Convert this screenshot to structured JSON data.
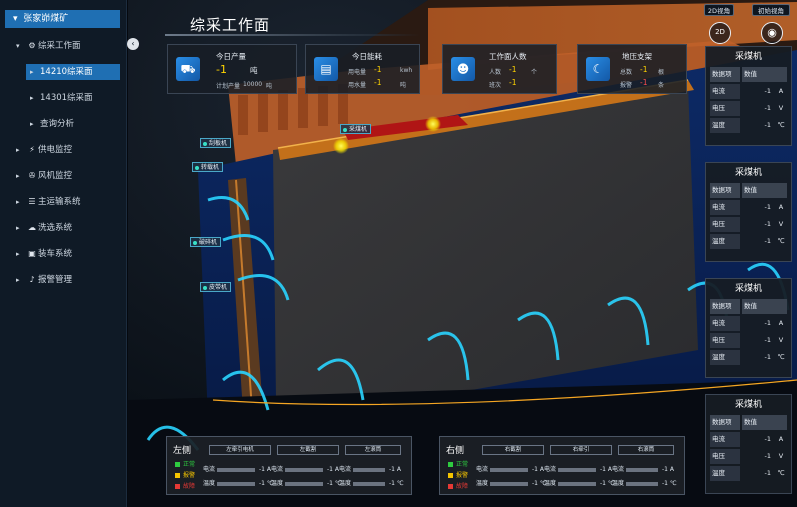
{
  "sidebar": {
    "root": "张家峁煤矿",
    "items": [
      {
        "label": "综采工作面",
        "icon": "gear"
      },
      {
        "label": "14210综采面"
      },
      {
        "label": "14301综采面"
      },
      {
        "label": "查询分析"
      },
      {
        "label": "供电监控",
        "icon": "lightning"
      },
      {
        "label": "风机监控",
        "icon": "fan"
      },
      {
        "label": "主运输系统",
        "icon": "conveyor"
      },
      {
        "label": "洗选系统",
        "icon": "wash"
      },
      {
        "label": "装车系统",
        "icon": "truck"
      },
      {
        "label": "报警管理",
        "icon": "bell"
      }
    ]
  },
  "header": {
    "title": "综采工作面",
    "btn1": "2D视角",
    "btn2": "初始视角",
    "circle1": "2D"
  },
  "stats": [
    {
      "title": "今日产量",
      "value": "-1",
      "unit": "吨",
      "sub_label": "计划产量",
      "sub_value": "10000",
      "sub_unit": "吨",
      "icon": "cart-icon"
    },
    {
      "title": "今日能耗",
      "label1": "用电量",
      "value1": "-1",
      "unit1": "kwh",
      "label2": "用水量",
      "value2": "-1",
      "unit2": "吨",
      "icon": "chart-icon"
    },
    {
      "title": "工作面人数",
      "label1": "人数",
      "value1": "-1",
      "unit1": "个",
      "label2": "班次",
      "value2": "-1",
      "icon": "worker-icon"
    },
    {
      "title": "地压支架",
      "label1": "总数",
      "value1": "-1",
      "unit1": "根",
      "label2": "报警",
      "value2": "-1",
      "unit2": "条",
      "icon": "support-icon"
    }
  ],
  "right_panels": [
    {
      "title": "采煤机",
      "h1": "数据项",
      "h2": "数值",
      "rows": [
        {
          "k": "电流",
          "v": "-1",
          "u": "A"
        },
        {
          "k": "电压",
          "v": "-1",
          "u": "V"
        },
        {
          "k": "温度",
          "v": "-1",
          "u": "℃"
        }
      ]
    },
    {
      "title": "采煤机",
      "h1": "数据项",
      "h2": "数值",
      "rows": [
        {
          "k": "电流",
          "v": "-1",
          "u": "A"
        },
        {
          "k": "电压",
          "v": "-1",
          "u": "V"
        },
        {
          "k": "温度",
          "v": "-1",
          "u": "℃"
        }
      ]
    },
    {
      "title": "采煤机",
      "h1": "数据项",
      "h2": "数值",
      "rows": [
        {
          "k": "电流",
          "v": "-1",
          "u": "A"
        },
        {
          "k": "电压",
          "v": "-1",
          "u": "V"
        },
        {
          "k": "温度",
          "v": "-1",
          "u": "℃"
        }
      ]
    },
    {
      "title": "采煤机",
      "h1": "数据项",
      "h2": "数值",
      "rows": [
        {
          "k": "电流",
          "v": "-1",
          "u": "A"
        },
        {
          "k": "电压",
          "v": "-1",
          "u": "V"
        },
        {
          "k": "温度",
          "v": "-1",
          "u": "℃"
        }
      ]
    }
  ],
  "bottom_left": {
    "side": "左侧",
    "legend": [
      {
        "label": "正常",
        "color": "#2ecc40"
      },
      {
        "label": "报警",
        "color": "#f5c400"
      },
      {
        "label": "故障",
        "color": "#e53935"
      }
    ],
    "panels": [
      {
        "title": "左牵引电机",
        "rows": [
          {
            "k": "电流",
            "v": "-1 A"
          },
          {
            "k": "温度",
            "v": "-1 ℃"
          }
        ]
      },
      {
        "title": "左截割",
        "rows": [
          {
            "k": "电流",
            "v": "-1 A"
          },
          {
            "k": "温度",
            "v": "-1 ℃"
          }
        ]
      },
      {
        "title": "左滚筒",
        "rows": [
          {
            "k": "电流",
            "v": "-1 A"
          },
          {
            "k": "温度",
            "v": "-1 ℃"
          }
        ]
      }
    ]
  },
  "bottom_right": {
    "side": "右侧",
    "legend": [
      {
        "label": "正常",
        "color": "#2ecc40"
      },
      {
        "label": "报警",
        "color": "#f5c400"
      },
      {
        "label": "故障",
        "color": "#e53935"
      }
    ],
    "panels": [
      {
        "title": "右截割",
        "rows": [
          {
            "k": "电流",
            "v": "-1 A"
          },
          {
            "k": "温度",
            "v": "-1 ℃"
          }
        ]
      },
      {
        "title": "右牵引",
        "rows": [
          {
            "k": "电流",
            "v": "-1 A"
          },
          {
            "k": "温度",
            "v": "-1 ℃"
          }
        ]
      },
      {
        "title": "右滚筒",
        "rows": [
          {
            "k": "电流",
            "v": "-1 A"
          },
          {
            "k": "温度",
            "v": "-1 ℃"
          }
        ]
      }
    ]
  },
  "scene_tags": {
    "t1": "刮板机",
    "t2": "转载机",
    "t3": "破碎机",
    "t4": "皮带机",
    "t5": "采煤机"
  },
  "colors": {
    "accent": "#1f6fb3",
    "value_yellow": "#ffd400",
    "alarm_red": "#ff4d4d",
    "ring_cyan": "#2ad4ff"
  }
}
